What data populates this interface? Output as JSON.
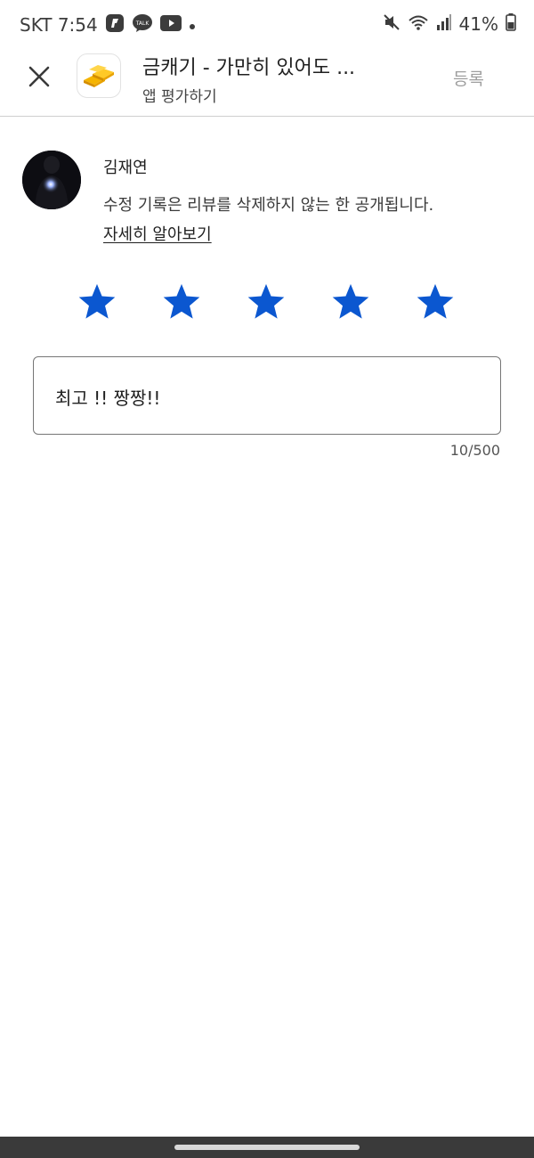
{
  "status_bar": {
    "carrier_time": "SKT 7:54",
    "battery": "41%"
  },
  "header": {
    "app_title": "금캐기 - 가만히 있어도 ...",
    "subtitle": "앱 평가하기",
    "submit_label": "등록"
  },
  "user": {
    "name": "김재연",
    "notice": "수정 기록은 리뷰를 삭제하지 않는 한 공개됩니다.",
    "learn_more": "자세히 알아보기"
  },
  "rating": {
    "value": 5,
    "max": 5,
    "star_color": "#0b57d0"
  },
  "review": {
    "text": "최고 !! 짱짱!!",
    "counter": "10/500"
  },
  "icons": {
    "close": "close-icon",
    "mute": "mute-icon",
    "wifi": "wifi-icon",
    "signal": "signal-icon",
    "battery": "battery-icon",
    "kakao_talk": "kakao-talk-icon",
    "youtube": "youtube-icon"
  }
}
